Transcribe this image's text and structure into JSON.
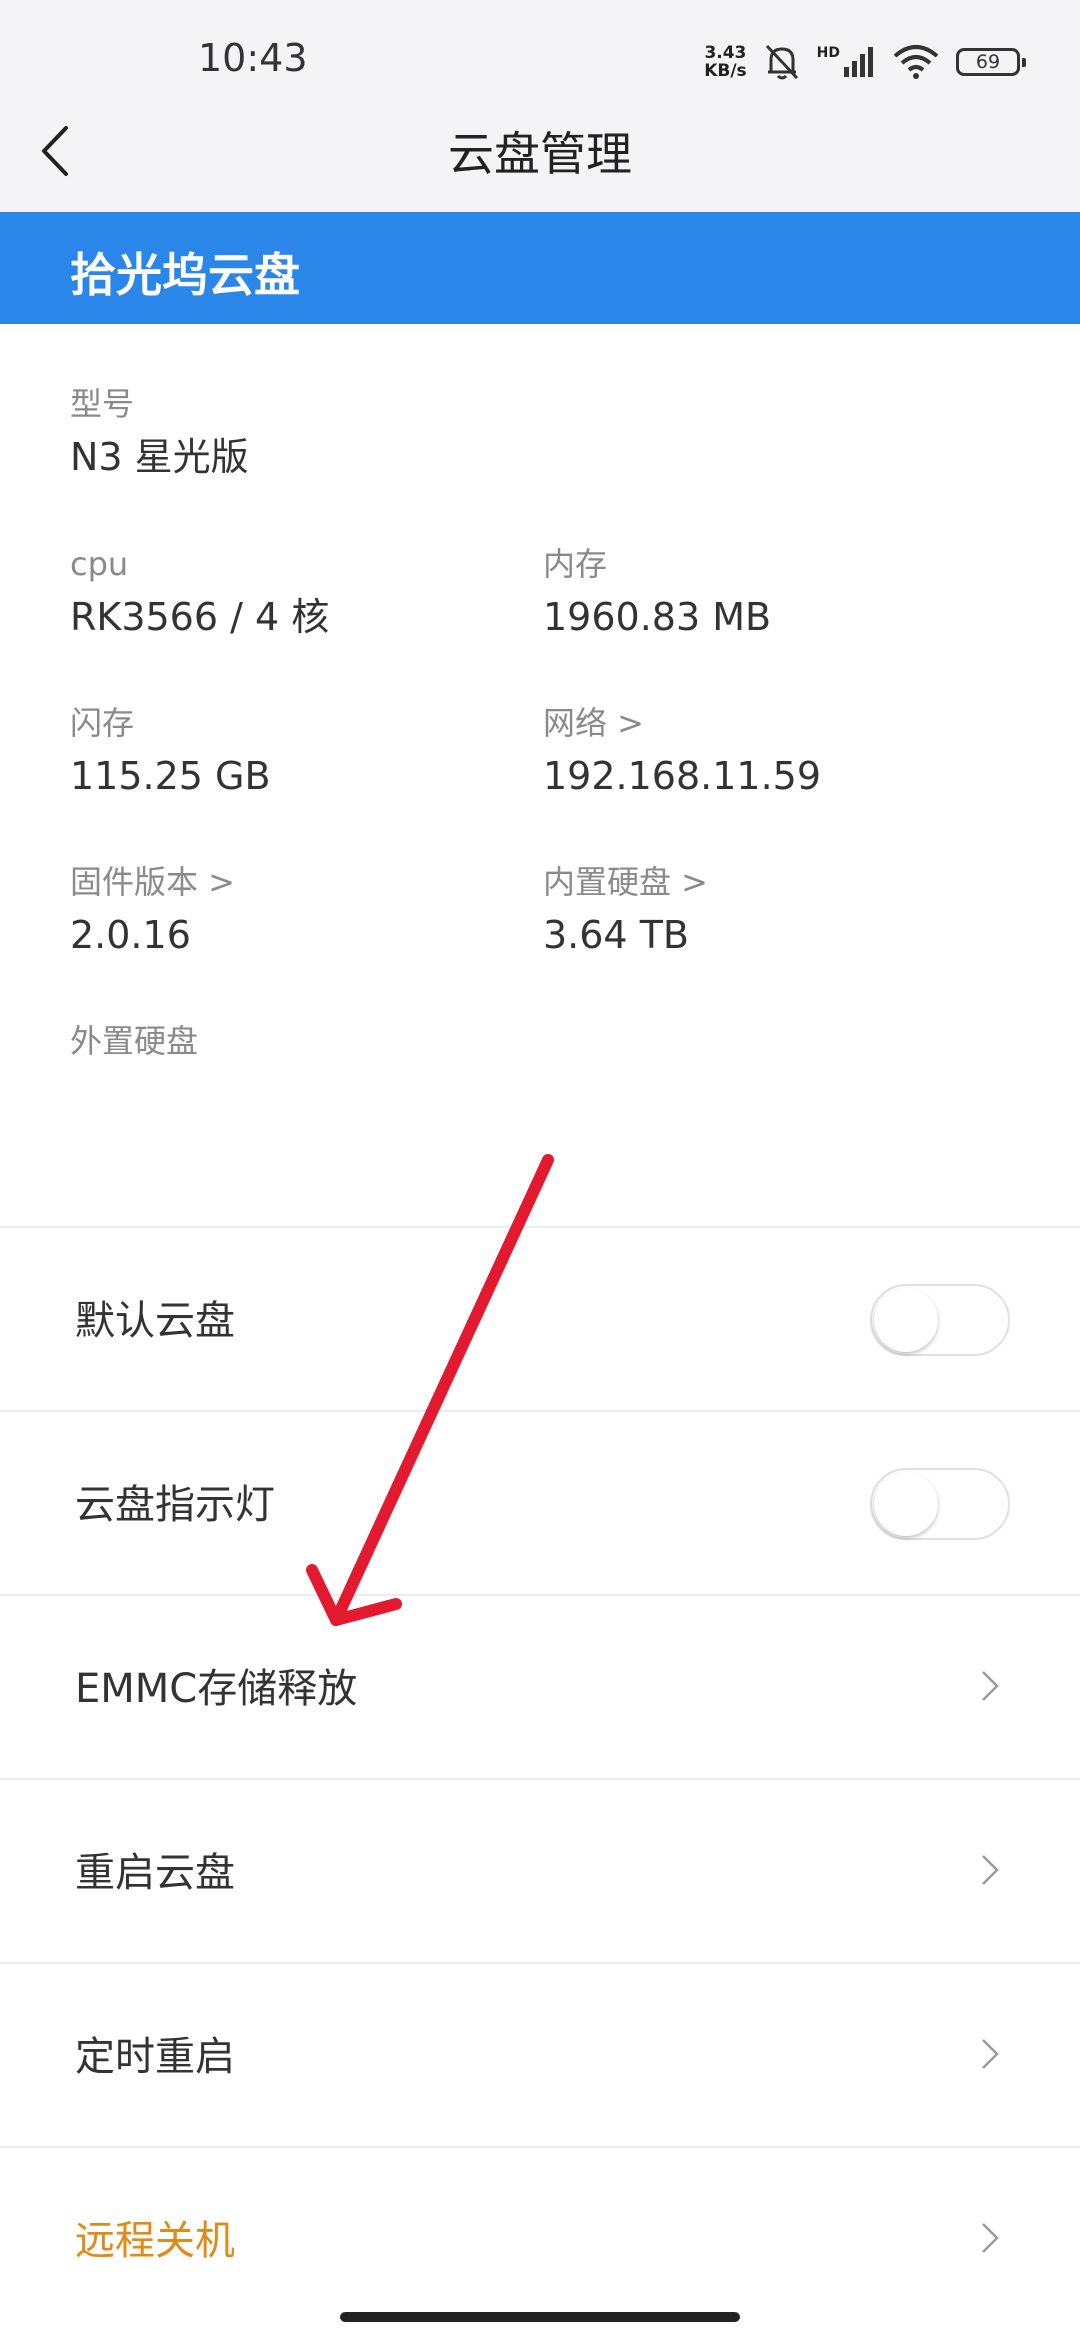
{
  "status_bar": {
    "time": "10:43",
    "net_speed_value": "3.43",
    "net_speed_unit": "KB/s",
    "signal_type": "HD",
    "battery_level": "69",
    "icons": [
      "mute-bell-icon",
      "cellular-signal-icon",
      "wifi-icon",
      "battery-icon"
    ]
  },
  "nav": {
    "title": "云盘管理",
    "back_icon": "chevron-left-icon"
  },
  "device": {
    "name": "拾光坞云盘",
    "accent_color": "#2b86e9"
  },
  "info": {
    "model": {
      "label": "型号",
      "value": "N3 星光版"
    },
    "cpu": {
      "label": "cpu",
      "value": "RK3566 / 4 核"
    },
    "memory": {
      "label": "内存",
      "value": "1960.83 MB"
    },
    "flash": {
      "label": "闪存",
      "value": "115.25 GB"
    },
    "network": {
      "label": "网络 >",
      "value": "192.168.11.59"
    },
    "firmware": {
      "label": "固件版本 >",
      "value": "2.0.16"
    },
    "internal_disk": {
      "label": "内置硬盘 >",
      "value": "3.64 TB"
    },
    "external_disk": {
      "label": "外置硬盘"
    }
  },
  "settings": [
    {
      "label": "默认云盘",
      "control": "toggle",
      "on": false
    },
    {
      "label": "云盘指示灯",
      "control": "toggle",
      "on": false
    },
    {
      "label": "EMMC存储释放",
      "control": "chevron"
    },
    {
      "label": "重启云盘",
      "control": "chevron"
    },
    {
      "label": "定时重启",
      "control": "chevron"
    },
    {
      "label": "远程关机",
      "control": "chevron",
      "color": "#e08a18"
    }
  ],
  "annotation": {
    "type": "red-arrow",
    "color": "#e3192f"
  }
}
